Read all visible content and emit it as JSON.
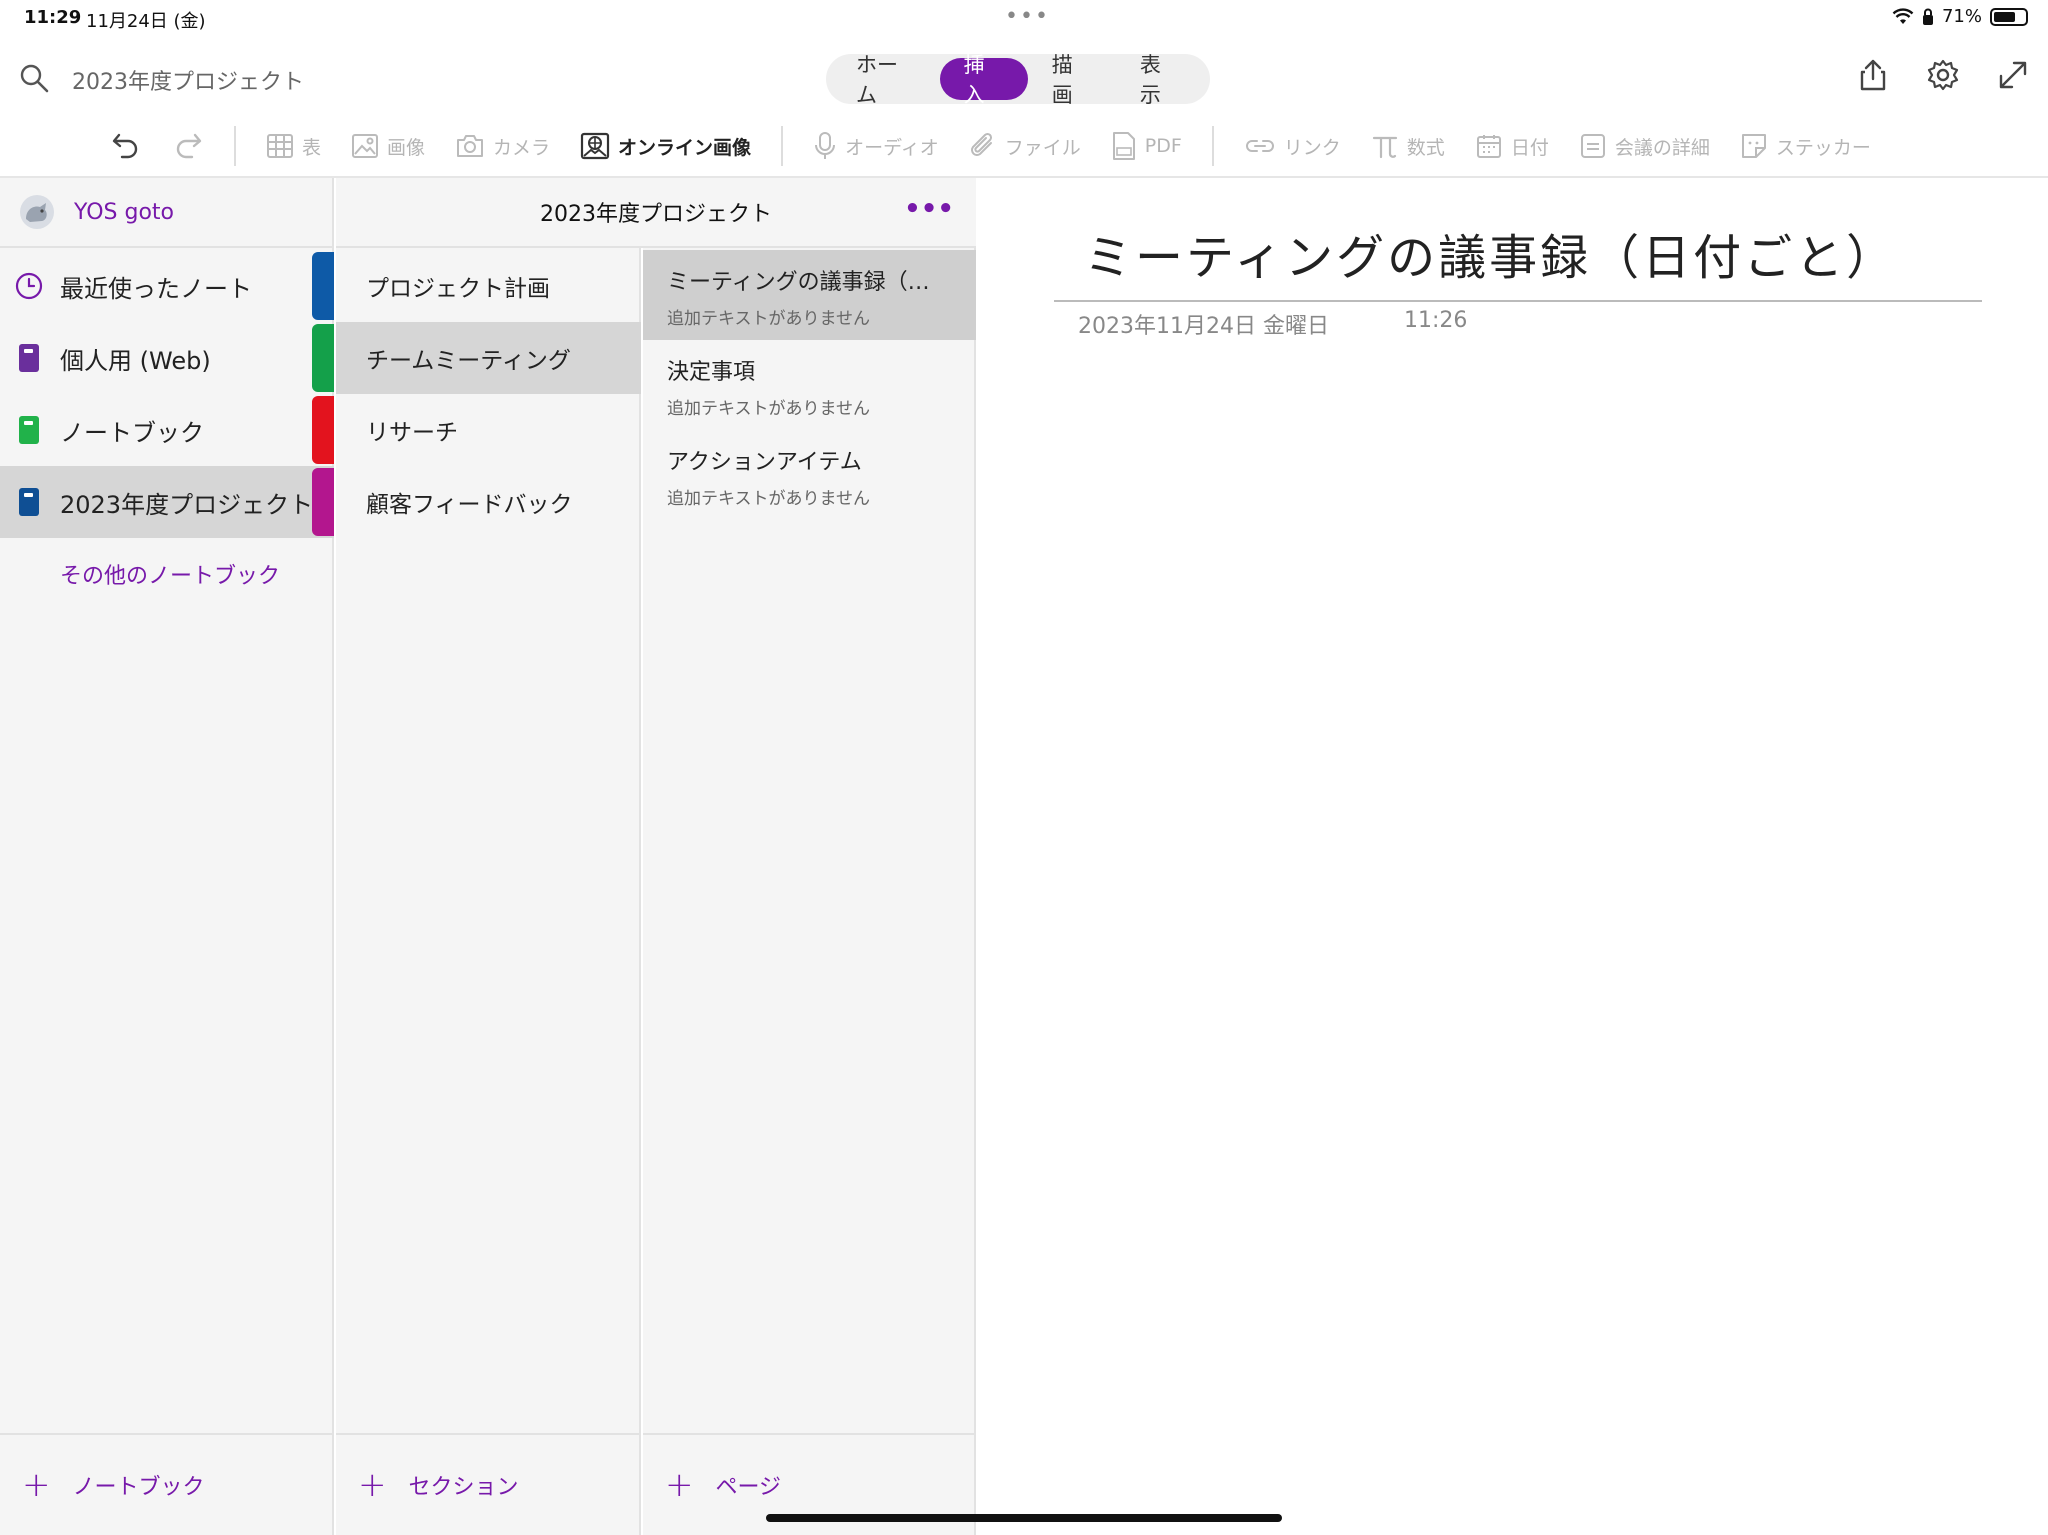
{
  "status_bar": {
    "time": "11:29",
    "date": "11月24日 (金)",
    "dots": "•••",
    "battery_percent": "71%",
    "battery_level": 0.71
  },
  "search": {
    "title": "2023年度プロジェクト",
    "icon": "search-icon"
  },
  "tabs": [
    {
      "label": "ホーム"
    },
    {
      "label": "挿入",
      "active": true
    },
    {
      "label": "描画"
    },
    {
      "label": "表示"
    }
  ],
  "top_icons": [
    "share-icon",
    "gear-icon",
    "expand-icon"
  ],
  "ribbon": {
    "table": "表",
    "image": "画像",
    "camera": "カメラ",
    "online_image": "オンライン画像",
    "audio": "オーディオ",
    "file": "ファイル",
    "pdf": "PDF",
    "link": "リンク",
    "math": "数式",
    "date": "日付",
    "meeting_details": "会議の詳細",
    "sticker": "ステッカー"
  },
  "account": {
    "name": "YOS goto"
  },
  "notebooks": [
    {
      "label": "最近使ったノート",
      "icon": "clock-icon",
      "color": "#7719aa",
      "tab_color": "#0e5aa7"
    },
    {
      "label": "個人用 (Web)",
      "icon": "notebook-icon",
      "color": "#6a2f9c",
      "tab_color": "#14a04a"
    },
    {
      "label": "ノートブック",
      "icon": "notebook-icon",
      "color": "#21b24a",
      "tab_color": "#e3131e"
    },
    {
      "label": "2023年度プロジェクト",
      "icon": "notebook-icon",
      "color": "#0f4f94",
      "tab_color": "#b3168e",
      "selected": true
    }
  ],
  "more_notebooks": "その他のノートブック",
  "add_notebook": "ノートブック",
  "section_header": "2023年度プロジェクト",
  "section_more": "•••",
  "sections": [
    {
      "label": "プロジェクト計画"
    },
    {
      "label": "チームミーティング",
      "selected": true
    },
    {
      "label": "リサーチ"
    },
    {
      "label": "顧客フィードバック"
    }
  ],
  "add_section": "セクション",
  "pages": [
    {
      "title": "ミーティングの議事録（…",
      "subtitle": "追加テキストがありません",
      "selected": true
    },
    {
      "title": "決定事項",
      "subtitle": "追加テキストがありません"
    },
    {
      "title": "アクションアイテム",
      "subtitle": "追加テキストがありません"
    }
  ],
  "add_page": "ページ",
  "page": {
    "title": "ミーティングの議事録（日付ごと）",
    "date": "2023年11月24日 金曜日",
    "time": "11:26"
  },
  "colors": {
    "accent": "#7719aa"
  }
}
